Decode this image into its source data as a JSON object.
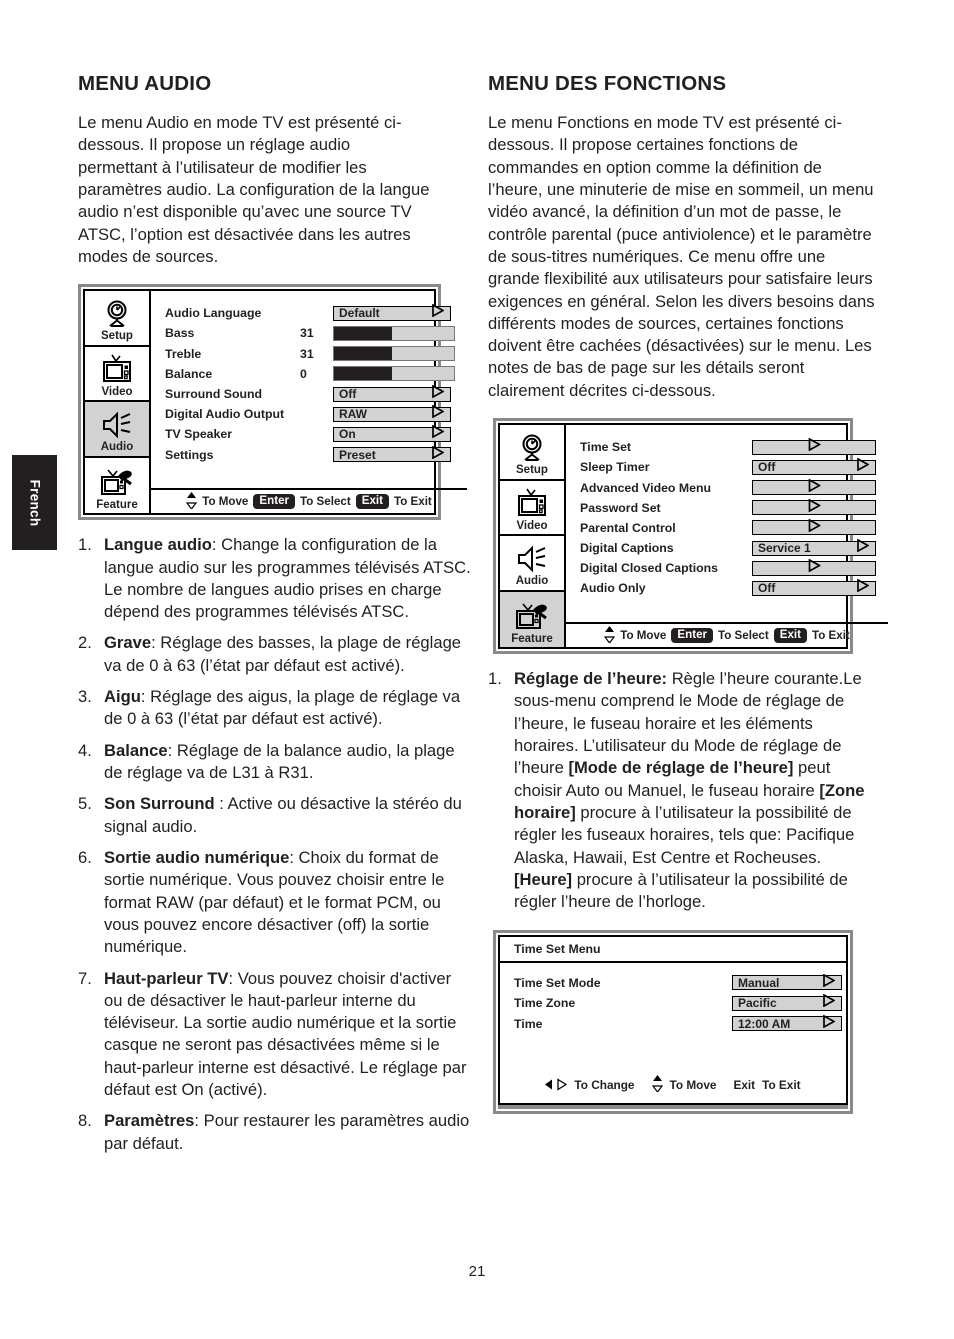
{
  "page": {
    "number": "21",
    "language_tab": "French"
  },
  "left_column": {
    "title": "MENU AUDIO",
    "intro": "Le menu Audio en mode TV est présenté ci-dessous. Il propose un réglage audio permettant à l’utilisateur de modifier les paramètres audio. La configuration de la langue audio n’est disponible qu’avec une source TV ATSC, l’option est désactivée dans les autres modes de sources.",
    "osd": {
      "sidebar": [
        {
          "label": "Setup",
          "icon": "satellite-clock-icon",
          "selected": false
        },
        {
          "label": "Video",
          "icon": "television-icon",
          "selected": false
        },
        {
          "label": "Audio",
          "icon": "speaker-icon",
          "selected": true
        },
        {
          "label": "Feature",
          "icon": "tv-tool-icon",
          "selected": false
        }
      ],
      "rows": [
        {
          "label": "Audio Language",
          "kind": "value",
          "value": "Default",
          "arrow": "right"
        },
        {
          "label": "Bass",
          "kind": "slider",
          "number": "31",
          "fill_pct": 48
        },
        {
          "label": "Treble",
          "kind": "slider",
          "number": "31",
          "fill_pct": 48
        },
        {
          "label": "Balance",
          "kind": "slider",
          "number": "0",
          "fill_pct": 48
        },
        {
          "label": "Surround Sound",
          "kind": "value",
          "value": "Off",
          "arrow": "right"
        },
        {
          "label": "Digital Audio Output",
          "kind": "value",
          "value": "RAW",
          "arrow": "right"
        },
        {
          "label": "TV Speaker",
          "kind": "value",
          "value": "On",
          "arrow": "right"
        },
        {
          "label": "Settings",
          "kind": "value",
          "value": "Preset",
          "arrow": "right"
        }
      ],
      "footer": {
        "move_label": "To Move",
        "enter_key": "Enter",
        "select_label": "To Select",
        "exit_key": "Exit",
        "exit_label": "To Exit"
      }
    },
    "list": [
      {
        "num": "1.",
        "bold": "Langue audio",
        "rest": ": Change la configuration de la langue audio sur les programmes télévisés ATSC. Le nombre de langues audio prises en charge dépend des programmes télévisés ATSC."
      },
      {
        "num": "2.",
        "bold": "Grave",
        "rest": ": Réglage des basses, la plage de réglage va de 0 à 63 (l’état par défaut est activé)."
      },
      {
        "num": "3.",
        "bold": "Aigu",
        "rest": ": Réglage des aigus, la plage de réglage va de 0 à 63 (l’état par défaut est activé)."
      },
      {
        "num": "4.",
        "bold": "Balance",
        "rest": ": Réglage de la balance audio, la plage de réglage va de L31 à R31."
      },
      {
        "num": "5.",
        "bold": "Son Surround",
        "rest": " : Active ou désactive la stéréo du signal audio."
      },
      {
        "num": "6.",
        "bold": "Sortie audio numérique",
        "rest": ": Choix du format de sortie numérique. Vous pouvez choisir entre le format RAW (par défaut) et le format PCM, ou vous pouvez encore désactiver (off) la sortie numérique."
      },
      {
        "num": "7.",
        "bold": "Haut-parleur TV",
        "rest": ": Vous pouvez choisir d'activer ou de désactiver le haut-parleur interne du téléviseur. La sortie audio numérique et la sortie casque ne seront pas désactivées même si le haut-parleur interne est désactivé. Le réglage par défaut est On (activé)."
      },
      {
        "num": "8.",
        "bold": "Paramètres",
        "rest": ": Pour restaurer les paramètres audio par défaut."
      }
    ]
  },
  "right_column": {
    "title": "MENU DES FONCTIONS",
    "intro": "Le menu Fonctions en mode TV est présenté ci-dessous. Il propose certaines fonctions de commandes en option comme la définition de l’heure, une minuterie de mise en sommeil, un menu vidéo avancé, la définition d’un mot de passe, le contrôle parental (puce antiviolence) et le paramètre de sous-titres numériques. Ce menu offre une grande flexibilité aux utilisateurs pour satisfaire leurs exigences en général. Selon les divers besoins dans différents modes de sources, certaines fonctions doivent être cachées (désactivées) sur le menu. Les notes de bas de page sur les détails seront clairement décrites ci-dessous.",
    "osd": {
      "sidebar": [
        {
          "label": "Setup",
          "icon": "satellite-clock-icon",
          "selected": false
        },
        {
          "label": "Video",
          "icon": "television-icon",
          "selected": false
        },
        {
          "label": "Audio",
          "icon": "speaker-icon",
          "selected": false
        },
        {
          "label": "Feature",
          "icon": "tv-tool-icon",
          "selected": true
        }
      ],
      "rows": [
        {
          "label": "Time Set",
          "kind": "value",
          "value": "",
          "arrow": "center"
        },
        {
          "label": "Sleep Timer",
          "kind": "value",
          "value": "Off",
          "arrow": "right"
        },
        {
          "label": "Advanced Video Menu",
          "kind": "value",
          "value": "",
          "arrow": "center"
        },
        {
          "label": "Password Set",
          "kind": "value",
          "value": "",
          "arrow": "center"
        },
        {
          "label": "Parental Control",
          "kind": "value",
          "value": "",
          "arrow": "center"
        },
        {
          "label": "Digital Captions",
          "kind": "value",
          "value": "Service 1",
          "arrow": "right"
        },
        {
          "label": "Digital Closed Captions",
          "kind": "value",
          "value": "",
          "arrow": "center"
        },
        {
          "label": "Audio Only",
          "kind": "value",
          "value": "Off",
          "arrow": "right"
        }
      ],
      "footer": {
        "move_label": "To Move",
        "enter_key": "Enter",
        "select_label": "To Select",
        "exit_key": "Exit",
        "exit_label": "To Exit"
      }
    },
    "list": [
      {
        "num": "1.",
        "bold": "Réglage de l’heure:",
        "rest": " Règle l’heure courante.Le sous-menu comprend le Mode de réglage de l’heure, le fuseau horaire et les éléments horaires. L’utilisateur du Mode de réglage de l’heure ",
        "bold2": "[Mode de réglage de l’heure]",
        "rest2": " peut choisir Auto ou Manuel, le fuseau horaire ",
        "bold3": "[Zone horaire]",
        "rest3": " procure à l’utilisateur la possibilité de régler les fuseaux horaires, tels que: Pacifique Alaska, Hawaii, Est Centre et Rocheuses. ",
        "bold4": "[Heure]",
        "rest4": " procure à l’utilisateur la possibilité de régler l’heure de l’horloge."
      }
    ],
    "time_set_menu": {
      "title": "Time Set Menu",
      "rows": [
        {
          "label": "Time Set Mode",
          "value": "Manual",
          "arrow": "right"
        },
        {
          "label": "Time Zone",
          "value": "Pacific",
          "arrow": "right"
        },
        {
          "label": "Time",
          "value": "12:00 AM",
          "arrow": "right"
        }
      ],
      "footer": {
        "change_label": "To Change",
        "move_label": "To Move",
        "exit_key": "Exit",
        "exit_label": "To Exit"
      }
    }
  },
  "colors": {
    "ink": "#231f20",
    "osd_gray": "#d2d2d2",
    "osd_border": "#8a8a8a",
    "slider_fill": "#231f20"
  }
}
